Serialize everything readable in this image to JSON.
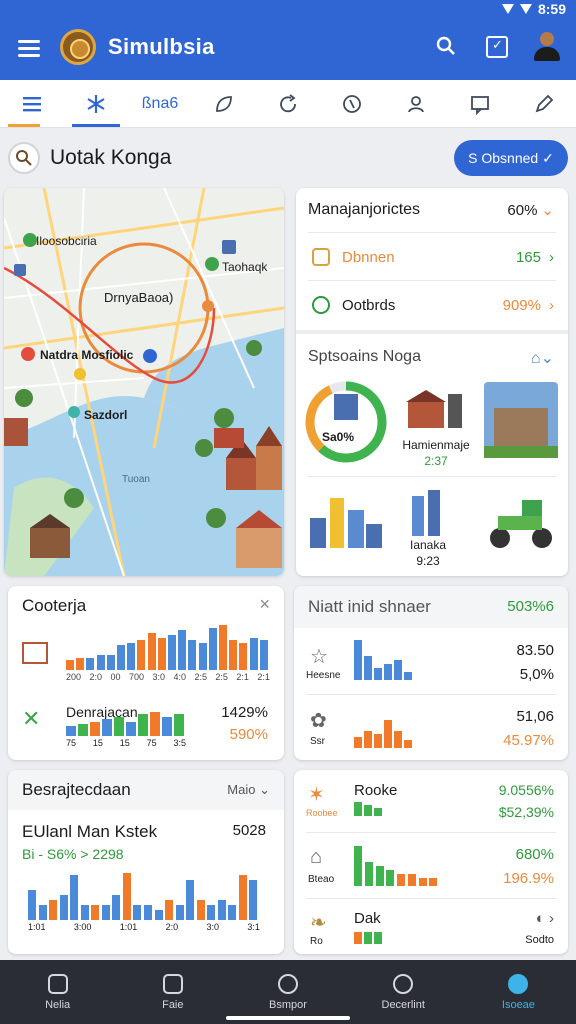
{
  "status": {
    "time": "8:59"
  },
  "appbar": {
    "title": "Simulbsia",
    "menu_icon": "hamburger-icon",
    "search_icon": "search-icon",
    "calendar_icon": "calendar-check-icon",
    "avatar_icon": "user-avatar-icon"
  },
  "tabs": [
    {
      "icon": "hamburger-icon",
      "label": ""
    },
    {
      "icon": "snowflake-icon",
      "label": ""
    },
    {
      "icon": "",
      "label": "ßna6"
    },
    {
      "icon": "leaf-icon",
      "label": ""
    },
    {
      "icon": "refresh-icon",
      "label": ""
    },
    {
      "icon": "coin-icon",
      "label": ""
    },
    {
      "icon": "person-icon",
      "label": ""
    },
    {
      "icon": "chat-icon",
      "label": ""
    },
    {
      "icon": "edit-icon",
      "label": ""
    }
  ],
  "location": {
    "text": "Uotak Konga"
  },
  "chip": {
    "label": "S Obsnned ✓"
  },
  "map": {
    "labels": {
      "poi1": "Iloosobciria",
      "poi2": "Taohaqk",
      "circle": "DrnyaBaoa)",
      "poi3": "Natdra Mosfiolic",
      "poi4": "Sazdorl",
      "water": "Tuoan"
    }
  },
  "summary": {
    "header": {
      "title": "Manajanjorictes",
      "value": "60%"
    },
    "rows": [
      {
        "label": "Dbnnen",
        "value": "165"
      },
      {
        "label": "Ootbrds",
        "value": "909%"
      }
    ]
  },
  "sports": {
    "title": "Sptsoains Noga",
    "ring_label": "Sa0%",
    "tiles": [
      {
        "label": "Hamienmaje",
        "sub": "2:37"
      },
      {
        "label": "Ianaka",
        "sub": "9:23"
      }
    ]
  },
  "cooterja": {
    "title": "Cooterja",
    "axis": [
      "200",
      "2:0",
      "00",
      "700",
      "3:0",
      "4:0",
      "2:5",
      "2:5",
      "2:1",
      "2:1"
    ],
    "row2": {
      "label": "Denrajacan",
      "value": "1429%",
      "sub": "590%"
    },
    "axis2": [
      "75",
      "15",
      "15",
      "75",
      "3:5"
    ]
  },
  "niatt": {
    "title": "Niatt inid shnaer",
    "value": "503%6",
    "rows": [
      {
        "label": "Heesne",
        "v1": "83.50",
        "v2": "5,0%"
      },
      {
        "label": "Ssr",
        "v1": "51,06",
        "v2": "45.97%"
      }
    ]
  },
  "besra": {
    "title": "Besrajtecdaan",
    "filter": "Maio",
    "subtitle": "EUlanl Man Kstek",
    "subtitle_value": "5028",
    "legend": "Bi - S6% > 2298",
    "axis": [
      "1:01",
      "3:00",
      "1:01",
      "2:0",
      "3:0",
      "3:1"
    ]
  },
  "rooke": {
    "rows": [
      {
        "label": "Rooke",
        "sub": "Roobee",
        "v1": "9.0556%",
        "v2": "$52,39%"
      },
      {
        "label": "Bteao",
        "v1": "680%",
        "v2": "196.9%"
      },
      {
        "label": "Dak",
        "sub": "Ro",
        "v2": "Sodto"
      }
    ]
  },
  "bottomnav": [
    {
      "icon": "home-icon",
      "label": "Nelia"
    },
    {
      "icon": "square-icon",
      "label": "Faie"
    },
    {
      "icon": "clock-icon",
      "label": "Bsmpor"
    },
    {
      "icon": "people-icon",
      "label": "Decerlint"
    },
    {
      "icon": "compass-icon",
      "label": "Isoeae"
    }
  ]
}
